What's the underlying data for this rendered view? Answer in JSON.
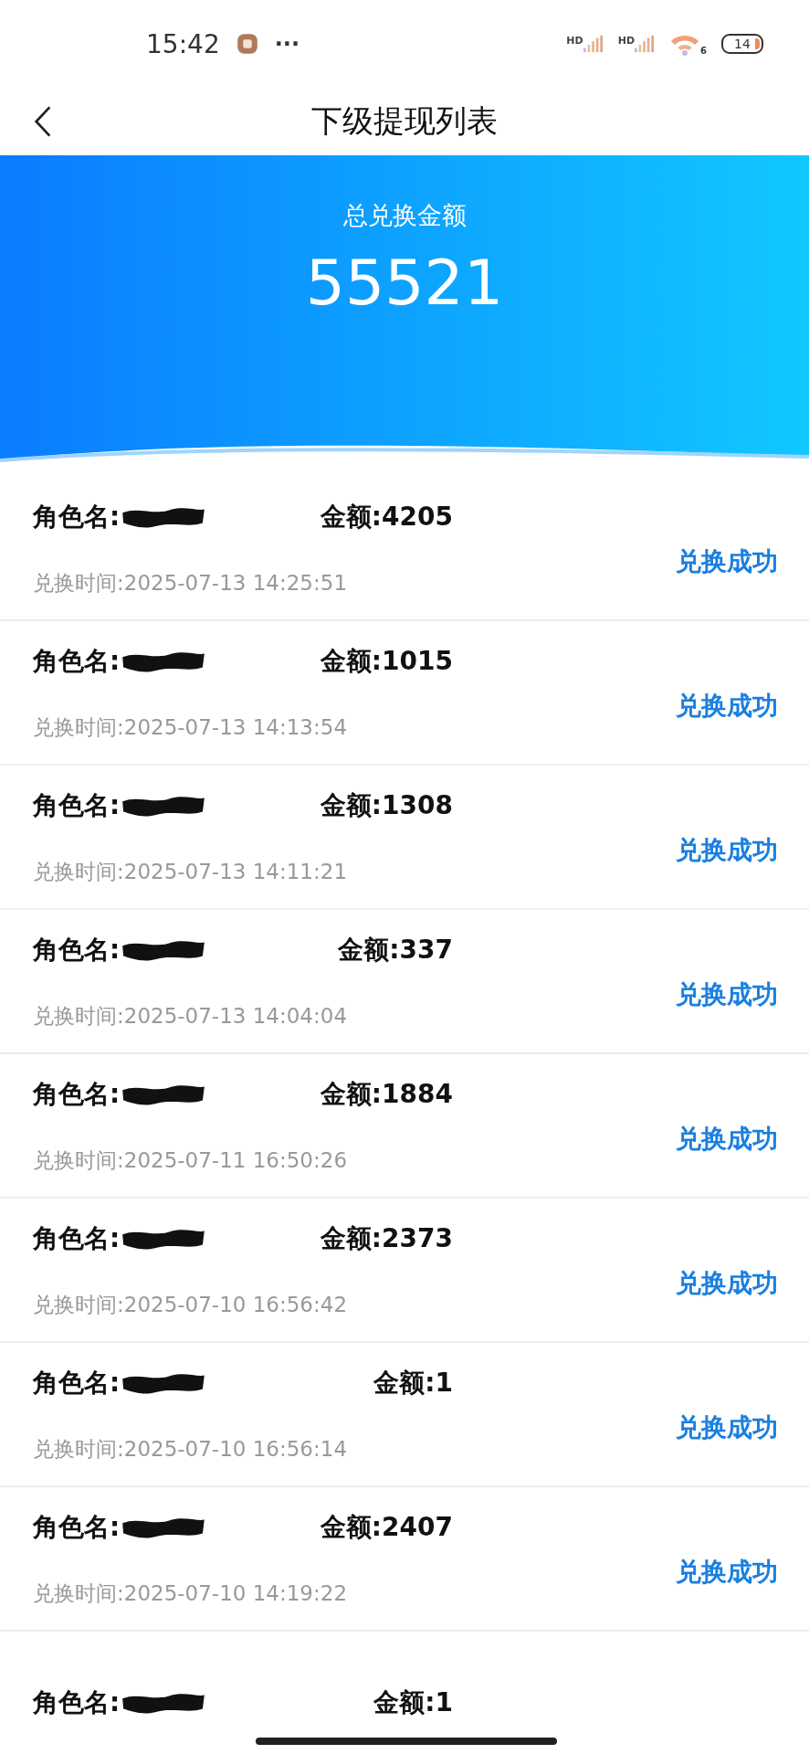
{
  "status_bar": {
    "time": "15:42",
    "more": "···",
    "sim_labels": [
      "HD",
      "HD"
    ],
    "wifi_badge": "6",
    "battery": "14"
  },
  "nav": {
    "title": "下级提现列表"
  },
  "summary": {
    "label": "总兑换金额",
    "total": "55521"
  },
  "records": [
    {
      "name_label": "角色名:",
      "amount": "金额:4205",
      "time": "兑换时间:2025-07-13 14:25:51",
      "status": "兑换成功"
    },
    {
      "name_label": "角色名:",
      "amount": "金额:1015",
      "time": "兑换时间:2025-07-13 14:13:54",
      "status": "兑换成功"
    },
    {
      "name_label": "角色名:",
      "amount": "金额:1308",
      "time": "兑换时间:2025-07-13 14:11:21",
      "status": "兑换成功"
    },
    {
      "name_label": "角色名:",
      "amount": "金额:337",
      "time": "兑换时间:2025-07-13 14:04:04",
      "status": "兑换成功"
    },
    {
      "name_label": "角色名:",
      "amount": "金额:1884",
      "time": "兑换时间:2025-07-11 16:50:26",
      "status": "兑换成功"
    },
    {
      "name_label": "角色名:",
      "amount": "金额:2373",
      "time": "兑换时间:2025-07-10 16:56:42",
      "status": "兑换成功"
    },
    {
      "name_label": "角色名:",
      "amount": "金额:1",
      "time": "兑换时间:2025-07-10 16:56:14",
      "status": "兑换成功"
    },
    {
      "name_label": "角色名:",
      "amount": "金额:2407",
      "time": "兑换时间:2025-07-10 14:19:22",
      "status": "兑换成功"
    },
    {
      "name_label": "角色名:",
      "amount": "金额:1"
    }
  ]
}
